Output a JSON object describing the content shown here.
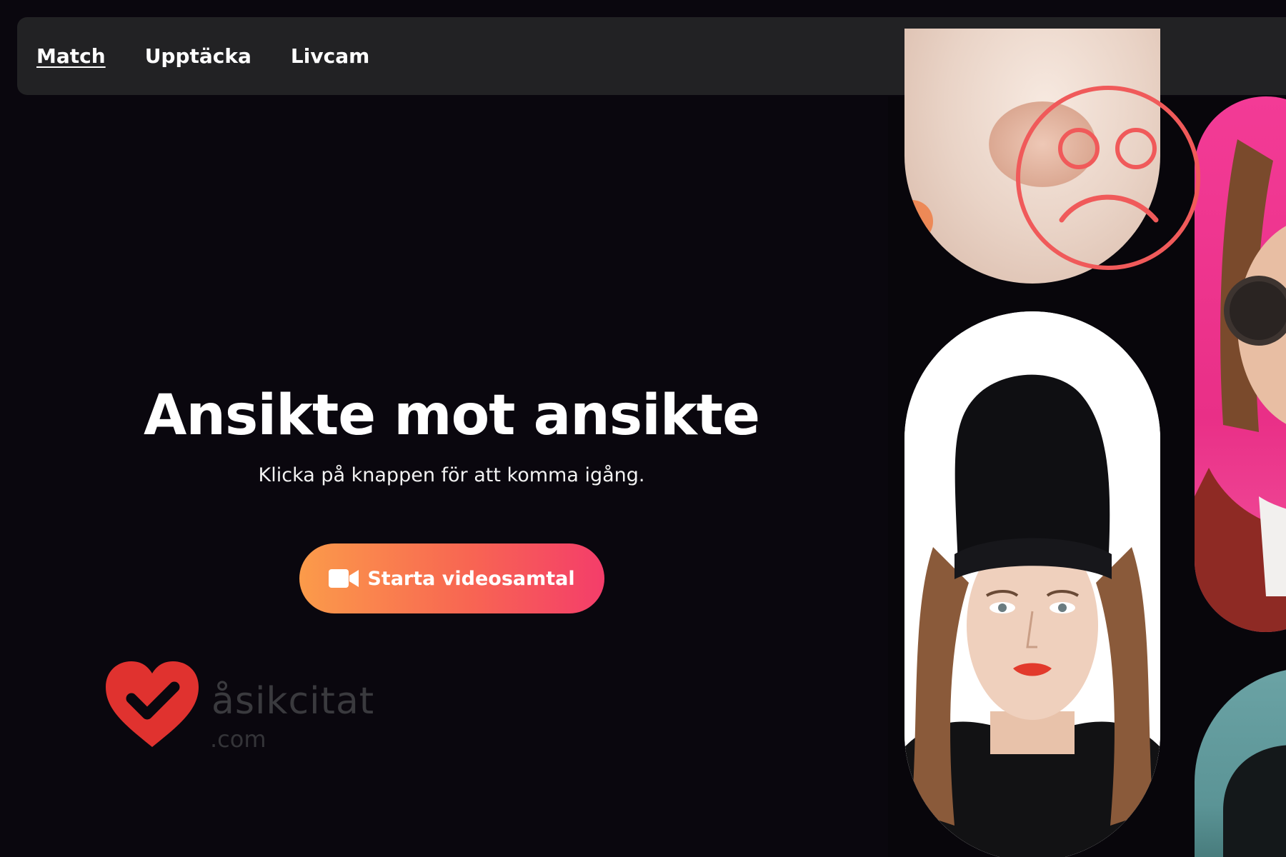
{
  "nav": {
    "items": [
      {
        "label": "Match",
        "active": true
      },
      {
        "label": "Upptäcka",
        "active": false
      },
      {
        "label": "Livcam",
        "active": false
      }
    ]
  },
  "hero": {
    "title": "Ansikte mot ansikte",
    "subtitle": "Klicka på knappen för att komma igång.",
    "cta_label": "Starta videosamtal",
    "cta_icon": "video-camera-icon"
  },
  "watermark": {
    "name": "åsikcitat",
    "domain": ".com",
    "icon": "heart-check-icon"
  },
  "annotation": {
    "icon": "sad-face-icon",
    "color": "#f05a5a"
  },
  "colors": {
    "background": "#0a070e",
    "navbar": "#222224",
    "cta_gradient_start": "#fb9b4a",
    "cta_gradient_end": "#f43d6a",
    "watermark_heart": "#e0322f"
  }
}
